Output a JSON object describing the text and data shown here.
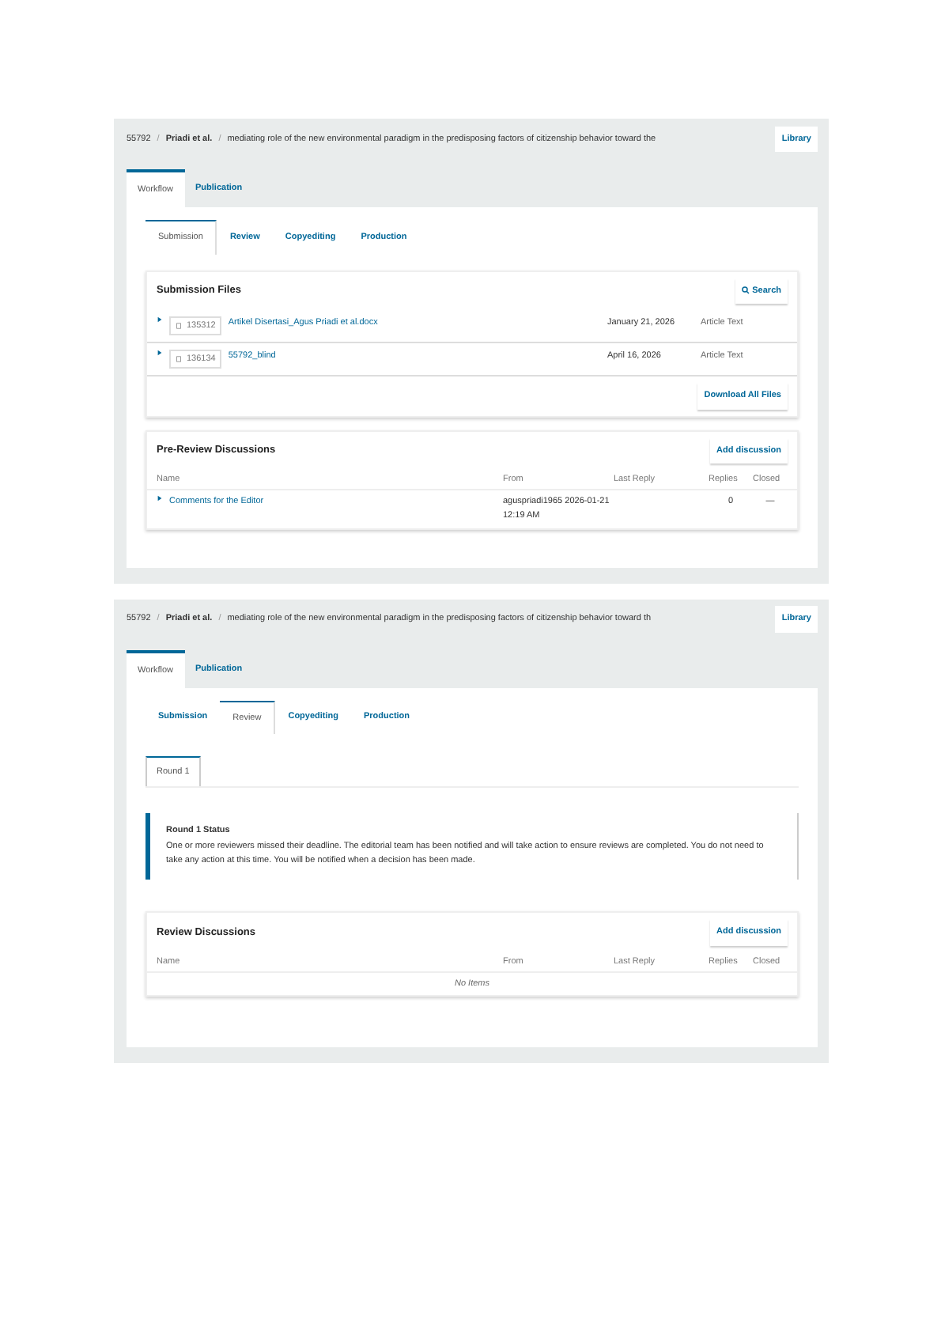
{
  "screens": [
    {
      "header": {
        "id": "55792",
        "separator": "/",
        "author": "Priadi et al.",
        "title": "mediating role of the new environmental paradigm in the predisposing factors of citizenship behavior toward the",
        "library": "Library"
      },
      "tabs": [
        {
          "label": "Workflow",
          "selected": true
        },
        {
          "label": "Publication",
          "selected": false
        }
      ],
      "stage_tabs": [
        {
          "label": "Submission",
          "selected": true
        },
        {
          "label": "Review",
          "selected": false
        },
        {
          "label": "Copyediting",
          "selected": false
        },
        {
          "label": "Production",
          "selected": false
        }
      ],
      "panels": [
        {
          "kind": "files",
          "title": "Submission Files",
          "search": "Search",
          "rows": [
            {
              "id": "135312",
              "name": "Artikel Disertasi_Agus Priadi et al.docx",
              "date": "January 21, 2026",
              "type": "Article Text"
            },
            {
              "id": "136134",
              "name": "55792_blind",
              "date": "April 16, 2026",
              "type": "Article Text"
            }
          ],
          "footer_button": "Download All Files"
        },
        {
          "kind": "discussions",
          "title": "Pre-Review Discussions",
          "add_button": "Add discussion",
          "columns": [
            "Name",
            "From",
            "Last Reply",
            "Replies",
            "Closed"
          ],
          "rows": [
            {
              "name": "Comments for the Editor",
              "from": "aguspriadi1965 2026-01-21 12:19 AM",
              "replies": "0",
              "closed": "—"
            }
          ]
        }
      ]
    },
    {
      "header": {
        "id": "55792",
        "separator": "/",
        "author": "Priadi et al.",
        "title": "mediating role of the new environmental paradigm in the predisposing factors of citizenship behavior toward th",
        "library": "Library"
      },
      "tabs": [
        {
          "label": "Workflow",
          "selected": true
        },
        {
          "label": "Publication",
          "selected": false
        }
      ],
      "stage_tabs": [
        {
          "label": "Submission",
          "selected": false
        },
        {
          "label": "Review",
          "selected": true
        },
        {
          "label": "Copyediting",
          "selected": false
        },
        {
          "label": "Production",
          "selected": false
        }
      ],
      "panels": [
        {
          "kind": "round_tabs",
          "tabs": [
            {
              "label": "Round 1",
              "selected": true
            }
          ]
        },
        {
          "kind": "notice",
          "title": "Round 1 Status",
          "text": "One or more reviewers missed their deadline. The editorial team has been notified and will take action to ensure reviews are completed. You do not need to take any action at this time. You will be notified when a decision has been made."
        },
        {
          "kind": "discussions",
          "title": "Review Discussions",
          "add_button": "Add discussion",
          "columns": [
            "Name",
            "From",
            "Last Reply",
            "Replies",
            "Closed"
          ],
          "empty": "No Items"
        }
      ]
    }
  ]
}
